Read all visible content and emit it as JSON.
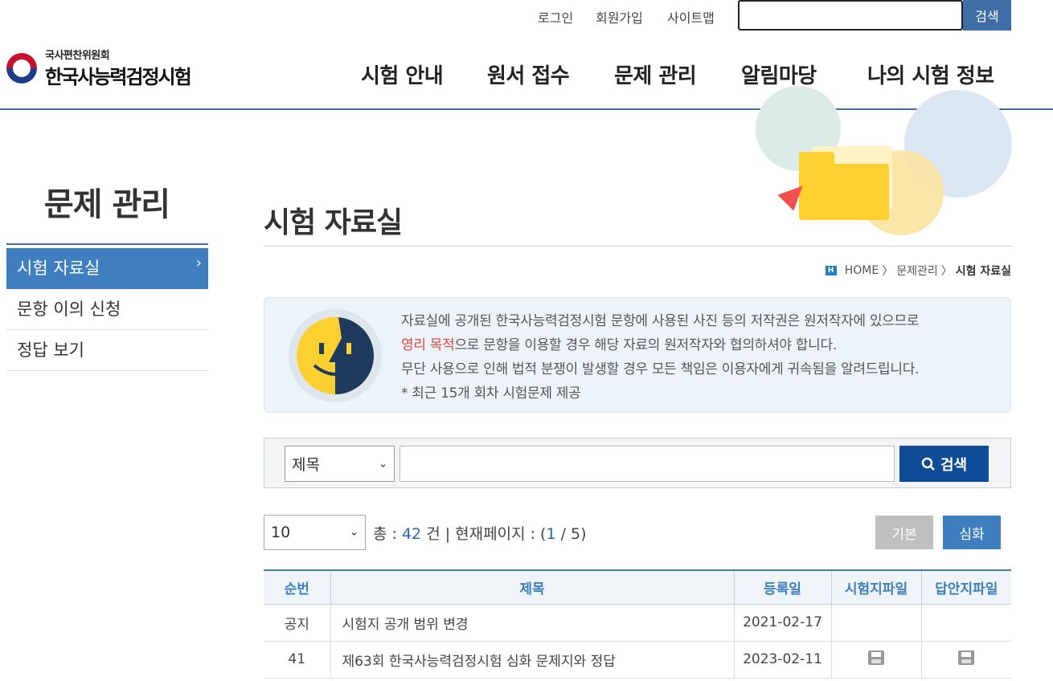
{
  "util": {
    "login": "로그인",
    "join": "회원가입",
    "sitemap": "사이트맵",
    "search_value": "",
    "search_button": "검색"
  },
  "logo": {
    "sub": "국사편찬위원회",
    "main": "한국사능력검정시험"
  },
  "gnb": [
    "시험 안내",
    "원서 접수",
    "문제 관리",
    "알림마당",
    "나의 시험 정보"
  ],
  "sidebar": {
    "title": "문제 관리",
    "items": [
      {
        "label": "시험 자료실",
        "active": true
      },
      {
        "label": "문항 이의 신청",
        "active": false
      },
      {
        "label": "정답 보기",
        "active": false
      }
    ],
    "chevron": "›"
  },
  "page": {
    "title": "시험 자료실",
    "breadcrumb": {
      "icon": "H",
      "home": "HOME",
      "sep": "〉",
      "section": "문제관리",
      "current": "시험 자료실"
    }
  },
  "notice": {
    "line1": "자료실에 공개된 한국사능력검정시험 문항에 사용된 사진 등의 저작권은 원저작자에 있으므로",
    "line2_red": "영리 목적",
    "line2_rest": "으로 문항을 이용할 경우 해당 자료의 원저작자와 협의하셔야 합니다.",
    "line3": "무단 사용으로 인해 법적 분쟁이 발생할 경우 모든 책임은 이용자에게 귀속됨을 알려드립니다.",
    "line4": "* 최근 15개 회차 시험문제 제공"
  },
  "search": {
    "field_selected": "제목",
    "query": "",
    "button": "검색"
  },
  "list_controls": {
    "page_size": "10",
    "total_prefix": "총 : ",
    "total_count": "42",
    "total_suffix": " 건 | 현재페이지 : (",
    "current_page": "1",
    "page_sep": " / ",
    "total_pages": "5",
    "page_suffix": ")",
    "basic_button": "기본",
    "advanced_button": "심화"
  },
  "table": {
    "headers": [
      "순번",
      "제목",
      "등록일",
      "시험지파일",
      "답안지파일"
    ],
    "rows": [
      {
        "no": "공지",
        "title": "시험지 공개 범위 변경",
        "date": "2021-02-17",
        "exam_file": false,
        "answer_file": false
      },
      {
        "no": "41",
        "title": "제63회 한국사능력검정시험 심화 문제지와 정답",
        "date": "2023-02-11",
        "exam_file": true,
        "answer_file": true
      }
    ]
  },
  "colors": {
    "accent": "#3f7fbf",
    "dark_button": "#0f4c97",
    "red_text": "#e0453a"
  }
}
